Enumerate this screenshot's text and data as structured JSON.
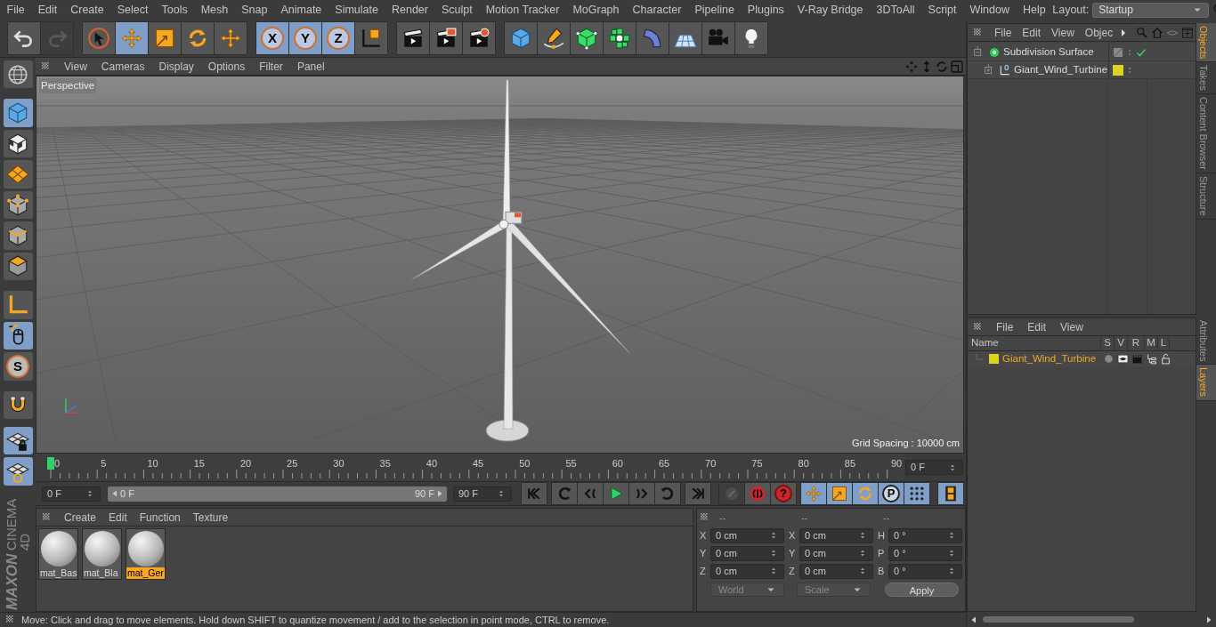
{
  "menu_bar": [
    "File",
    "Edit",
    "Create",
    "Select",
    "Tools",
    "Mesh",
    "Snap",
    "Animate",
    "Simulate",
    "Render",
    "Sculpt",
    "Motion Tracker",
    "MoGraph",
    "Character",
    "Pipeline",
    "Plugins",
    "V-Ray Bridge",
    "3DToAll",
    "Script",
    "Window",
    "Help"
  ],
  "layout": {
    "label": "Layout:",
    "value": "Startup"
  },
  "toolbar": {
    "groups": [
      {
        "buttons": [
          {
            "selected": false,
            "disabled": false
          },
          {
            "selected": false,
            "disabled": true
          }
        ]
      },
      {
        "buttons": [
          {
            "selected": false,
            "disabled": false
          },
          {
            "selected": true,
            "disabled": false
          },
          {
            "selected": false,
            "disabled": false
          },
          {
            "selected": false,
            "disabled": false
          },
          {
            "selected": false,
            "disabled": false
          }
        ]
      },
      {
        "buttons": [
          {
            "label": "X",
            "selected": true,
            "disabled": false
          },
          {
            "label": "Y",
            "selected": true,
            "disabled": false
          },
          {
            "label": "Z",
            "selected": true,
            "disabled": false
          },
          {
            "selected": false,
            "disabled": false
          }
        ]
      },
      {
        "buttons": [
          {
            "selected": false,
            "disabled": false
          },
          {
            "selected": false,
            "disabled": false
          },
          {
            "selected": false,
            "disabled": false
          }
        ]
      },
      {
        "buttons": [
          {
            "selected": false,
            "disabled": false
          },
          {
            "selected": false,
            "disabled": false
          },
          {
            "selected": false,
            "disabled": false
          },
          {
            "selected": false,
            "disabled": false
          },
          {
            "selected": false,
            "disabled": false
          },
          {
            "selected": false,
            "disabled": false
          },
          {
            "selected": false,
            "disabled": false
          },
          {
            "selected": false,
            "disabled": false
          }
        ]
      }
    ]
  },
  "left_toolbar": [
    {
      "selected": false
    },
    {
      "selected": true
    },
    {
      "selected": false
    },
    {
      "selected": false
    },
    {
      "selected": false
    },
    {
      "selected": false
    },
    {
      "selected": false
    },
    {
      "selected": false
    },
    {
      "selected": true
    },
    {
      "label": "S",
      "selected": false
    },
    {
      "selected": false
    },
    {
      "selected": true
    },
    {
      "selected": true
    }
  ],
  "viewport": {
    "menu": [
      "View",
      "Cameras",
      "Display",
      "Options",
      "Filter",
      "Panel"
    ],
    "camera_label": "Perspective",
    "grid_spacing": "Grid Spacing : 10000 cm"
  },
  "timeline": {
    "ticks": [
      "0",
      "5",
      "10",
      "15",
      "20",
      "25",
      "30",
      "35",
      "40",
      "45",
      "50",
      "55",
      "60",
      "65",
      "70",
      "75",
      "80",
      "85",
      "90"
    ],
    "playhead": {
      "level": 0
    },
    "preview_range": {
      "level": 1
    },
    "current_frame": "0 F",
    "start_field": "0 F",
    "range_start": "0 F",
    "range_end": "90 F",
    "end_field": "90 F"
  },
  "playback": {
    "groups": [
      {
        "buttons": [
          {
            "selected": false,
            "disabled": false
          }
        ]
      },
      {
        "buttons": [
          {
            "selected": false,
            "disabled": false
          },
          {
            "selected": false,
            "disabled": false
          },
          {
            "selected": false,
            "disabled": false
          },
          {
            "selected": false,
            "disabled": false
          },
          {
            "selected": false,
            "disabled": false
          }
        ]
      },
      {
        "buttons": [
          {
            "selected": false,
            "disabled": false
          }
        ]
      },
      {
        "buttons": [
          {
            "selected": false,
            "disabled": true
          },
          {
            "selected": false,
            "disabled": false
          },
          {
            "label": "?",
            "selected": false,
            "disabled": false
          }
        ]
      },
      {
        "buttons": [
          {
            "selected": true,
            "disabled": false
          },
          {
            "selected": true,
            "disabled": false
          },
          {
            "selected": true,
            "disabled": false
          },
          {
            "label": "P",
            "selected": true,
            "disabled": false
          },
          {
            "selected": true,
            "disabled": false
          }
        ]
      },
      {
        "buttons": [
          {
            "selected": true,
            "disabled": false
          }
        ]
      }
    ]
  },
  "materials": {
    "menu": [
      "Create",
      "Edit",
      "Function",
      "Texture"
    ],
    "items": [
      {
        "name": "mat_Bas",
        "selected": false
      },
      {
        "name": "mat_Bla",
        "selected": false
      },
      {
        "name": "mat_Ger",
        "selected": true
      }
    ]
  },
  "coordinates": {
    "headers": [
      "--",
      "--",
      "--"
    ],
    "rows": [
      [
        {
          "axis": "X",
          "value": "0 cm"
        },
        {
          "axis": "X",
          "value": "0 cm"
        },
        {
          "axis": "H",
          "value": "0 °"
        }
      ],
      [
        {
          "axis": "Y",
          "value": "0 cm"
        },
        {
          "axis": "Y",
          "value": "0 cm"
        },
        {
          "axis": "P",
          "value": "0 °"
        }
      ],
      [
        {
          "axis": "Z",
          "value": "0 cm"
        },
        {
          "axis": "Z",
          "value": "0 cm"
        },
        {
          "axis": "B",
          "value": "0 °"
        }
      ]
    ],
    "dropdowns": [
      "World",
      "Scale"
    ],
    "apply": "Apply"
  },
  "status_bar": "Move: Click and drag to move elements. Hold down SHIFT to quantize movement / add to the selection in point mode, CTRL to remove.",
  "logo": [
    "MAXON",
    "CINEMA 4D"
  ],
  "objects_manager": {
    "menu": [
      "File",
      "Edit",
      "View",
      "Objec"
    ],
    "tree": [
      {
        "name": "Subdivision Surface",
        "expanded": true,
        "enabled": true,
        "children": [
          {
            "name": "Giant_Wind_Turbine",
            "expanded": false,
            "enabled": false,
            "color": "#dcd420"
          }
        ]
      }
    ]
  },
  "layer_manager": {
    "menu": [
      "File",
      "Edit",
      "View"
    ],
    "columns": [
      "Name",
      "S",
      "V",
      "R",
      "M",
      "L"
    ],
    "layers": [
      {
        "name": "Giant_Wind_Turbine",
        "color": "#dcd420"
      }
    ]
  },
  "side_tabs_top": [
    {
      "label": "Objects",
      "selected": true
    },
    {
      "label": "Takes",
      "selected": false
    },
    {
      "label": "Content Browser",
      "selected": false
    },
    {
      "label": "Structure",
      "selected": false
    }
  ],
  "side_tabs_bottom": [
    {
      "label": "Attributes",
      "selected": false
    },
    {
      "label": "Layers",
      "selected": true
    }
  ]
}
